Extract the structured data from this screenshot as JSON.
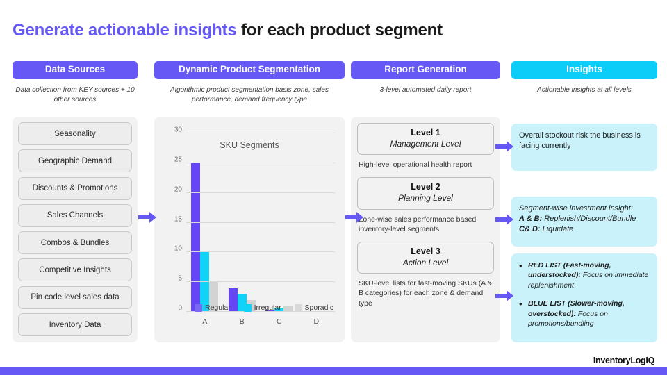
{
  "title": {
    "accent": "Generate actionable insights",
    "rest": " for each product segment"
  },
  "colors": {
    "purple": "#6558f5",
    "cyan": "#0ccdf8",
    "insight_card_bg": "#c9f2fb",
    "bar_regular": "#6645f4",
    "bar_irregular": "#10d3f8",
    "bar_sporadic": "#d3d3d3"
  },
  "columns": {
    "sources": {
      "header": "Data Sources",
      "subtitle": "Data collection from KEY sources + 10 other sources"
    },
    "segment": {
      "header": "Dynamic Product Segmentation",
      "subtitle": "Algorithmic product segmentation basis zone, sales performance, demand frequency type"
    },
    "report": {
      "header": "Report Generation",
      "subtitle": "3-level automated daily report"
    },
    "insights": {
      "header": "Insights",
      "subtitle": "Actionable insights at all levels"
    }
  },
  "sources": {
    "items": [
      "Seasonality",
      "Geographic Demand",
      "Discounts & Promotions",
      "Sales Channels",
      "Combos & Bundles",
      "Competitive Insights",
      "Pin code level sales data",
      "Inventory Data"
    ]
  },
  "report": {
    "levels": [
      {
        "name": "Level 1",
        "sub": "Management Level",
        "desc": "High-level operational health report"
      },
      {
        "name": "Level 2",
        "sub": "Planning Level",
        "desc": "Zone-wise sales performance based inventory-level segments"
      },
      {
        "name": "Level 3",
        "sub": "Action Level",
        "desc": "SKU-level lists for fast-moving SKUs (A & B categories) for each zone & demand type"
      }
    ]
  },
  "insights": {
    "card1": "Overall stockout risk the business is facing currently",
    "card2": {
      "line1": "Segment-wise investment insight:",
      "line2_bold": "A & B:",
      "line2_rest": " Replenish/Discount/Bundle",
      "line3_bold": "C& D:",
      "line3_rest": " Liquidate"
    },
    "card3": {
      "items": [
        {
          "bold": "RED LIST (Fast-moving, understocked):",
          "rest": " Focus on immediate replenishment"
        },
        {
          "bold": "BLUE LIST (Slower-moving, overstocked):",
          "rest": " Focus on promotions/bundling"
        }
      ]
    }
  },
  "footer": {
    "logo": "InventoryLogIQ"
  },
  "chart_data": {
    "type": "bar",
    "title": "SKU Segments",
    "xlabel": "",
    "ylabel": "",
    "categories": [
      "A",
      "B",
      "C",
      "D"
    ],
    "series": [
      {
        "name": "Regular",
        "values": [
          25,
          4,
          0.2,
          0.1
        ],
        "color": "#6645f4"
      },
      {
        "name": "Irregular",
        "values": [
          10,
          3,
          0.6,
          0.1
        ],
        "color": "#10d3f8"
      },
      {
        "name": "Sporadic",
        "values": [
          5,
          2,
          1.0,
          0.1
        ],
        "color": "#d3d3d3"
      }
    ],
    "ylim": [
      0,
      30
    ],
    "yticks": [
      0,
      5,
      10,
      15,
      20,
      25,
      30
    ],
    "grid": true,
    "legend_position": "inside-bottom"
  }
}
